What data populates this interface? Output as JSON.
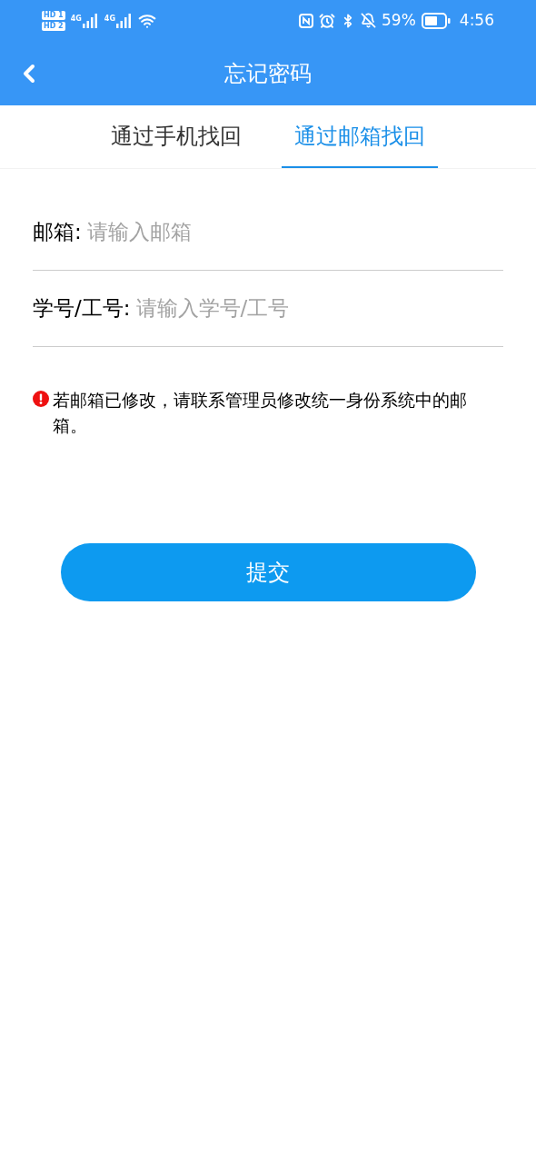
{
  "status_bar": {
    "sim_badges": [
      "HD 1",
      "HD 2"
    ],
    "networks": [
      "4G",
      "4G"
    ],
    "battery": "59%",
    "time": "4:56"
  },
  "header": {
    "title": "忘记密码"
  },
  "tabs": [
    {
      "label": "通过手机找回",
      "selected": false
    },
    {
      "label": "通过邮箱找回",
      "selected": true
    }
  ],
  "fields": [
    {
      "label": "邮箱:",
      "placeholder": "请输入邮箱"
    },
    {
      "label": "学号/工号:",
      "placeholder": "请输入学号/工号"
    }
  ],
  "notice": "若邮箱已修改，请联系管理员修改统一身份系统中的邮箱。",
  "submit": "提交"
}
